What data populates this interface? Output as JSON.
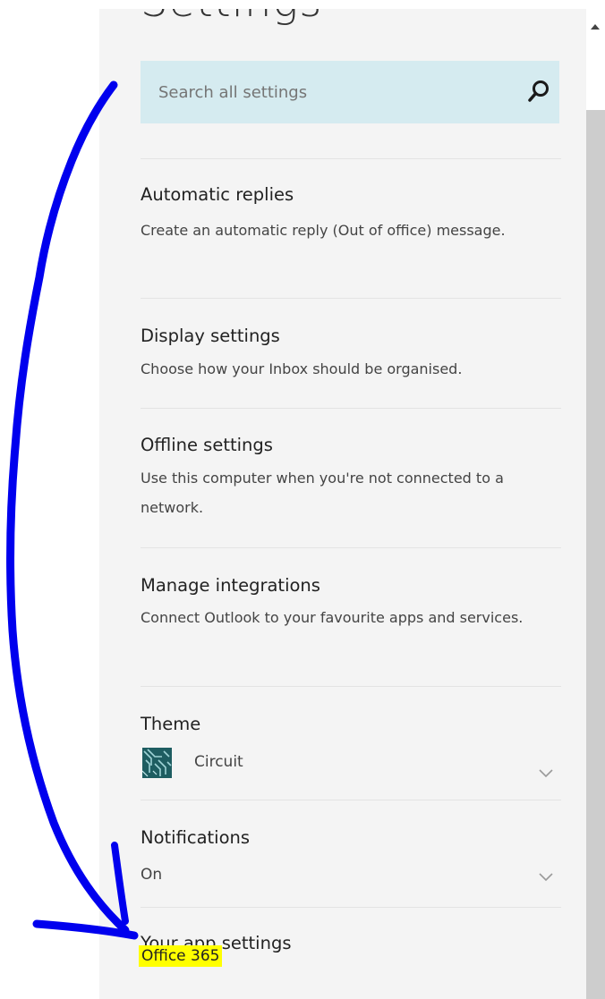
{
  "header": {
    "title": "Settings"
  },
  "search": {
    "placeholder": "Search all settings",
    "icon": "search-icon"
  },
  "items": {
    "automatic_replies": {
      "title": "Automatic replies",
      "desc": "Create an automatic reply (Out of office) message."
    },
    "display_settings": {
      "title": "Display settings",
      "desc": "Choose how your Inbox should be organised."
    },
    "offline_settings": {
      "title": "Offline settings",
      "desc": "Use this computer when you're not connected to a network."
    },
    "manage_integrations": {
      "title": "Manage integrations",
      "desc": "Connect Outlook to your favourite apps and services."
    }
  },
  "theme": {
    "label": "Theme",
    "value": "Circuit"
  },
  "notifications": {
    "label": "Notifications",
    "value": "On"
  },
  "app_settings": {
    "label": "Your app settings",
    "link": "Office 365"
  },
  "colors": {
    "accent_search": "#d5ebf0",
    "highlight": "#ffff00",
    "annotation": "#0000ee"
  }
}
